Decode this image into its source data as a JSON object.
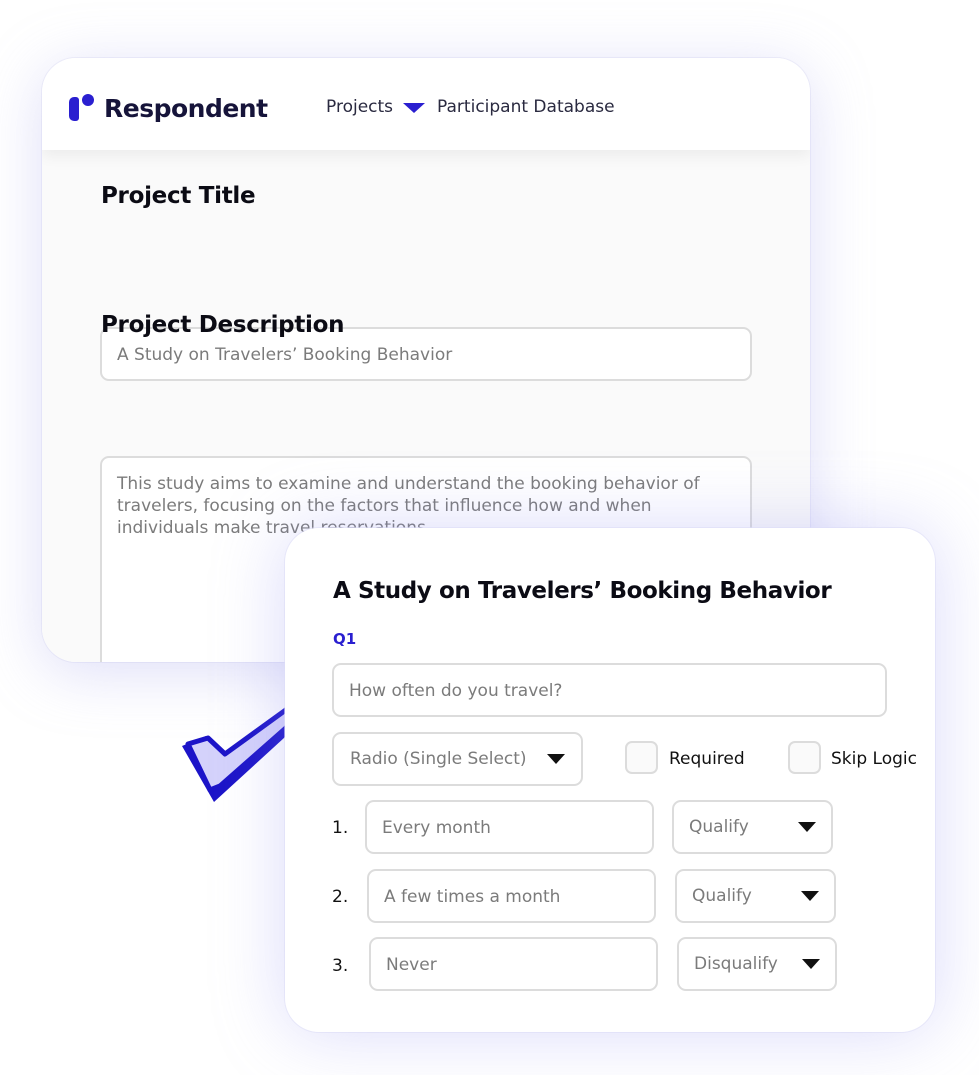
{
  "nav": {
    "brand": "Respondent",
    "projects": "Projects",
    "participant_database": "Participant Database"
  },
  "project_form": {
    "title_label": "Project Title",
    "title_value": "A Study on Travelers’ Booking Behavior",
    "description_label": "Project Description",
    "description_value": "This study aims to examine and understand the booking behavior of travelers, focusing on the factors that influence how and when individuals make travel reservations."
  },
  "survey": {
    "title": "A Study on Travelers’ Booking Behavior",
    "question_label": "Q1",
    "question_placeholder": "How often do you travel?",
    "question_type": "Radio (Single Select)",
    "required_label": "Required",
    "skip_logic_label": "Skip Logic",
    "required_checked": false,
    "skip_logic_checked": false,
    "answers": [
      {
        "number": "1.",
        "text": "Every month",
        "qualification": "Qualify"
      },
      {
        "number": "2.",
        "text": "A few times a month",
        "qualification": "Qualify"
      },
      {
        "number": "3.",
        "text": "Never",
        "qualification": "Disqualify"
      }
    ]
  },
  "colors": {
    "brand": "#2a1fd0",
    "checkmark_fill": "#d4d2fb",
    "checkmark_stroke": "#1c14c8"
  },
  "icons": [
    "logo-icon",
    "chevron-down-icon",
    "checkmark-icon"
  ]
}
